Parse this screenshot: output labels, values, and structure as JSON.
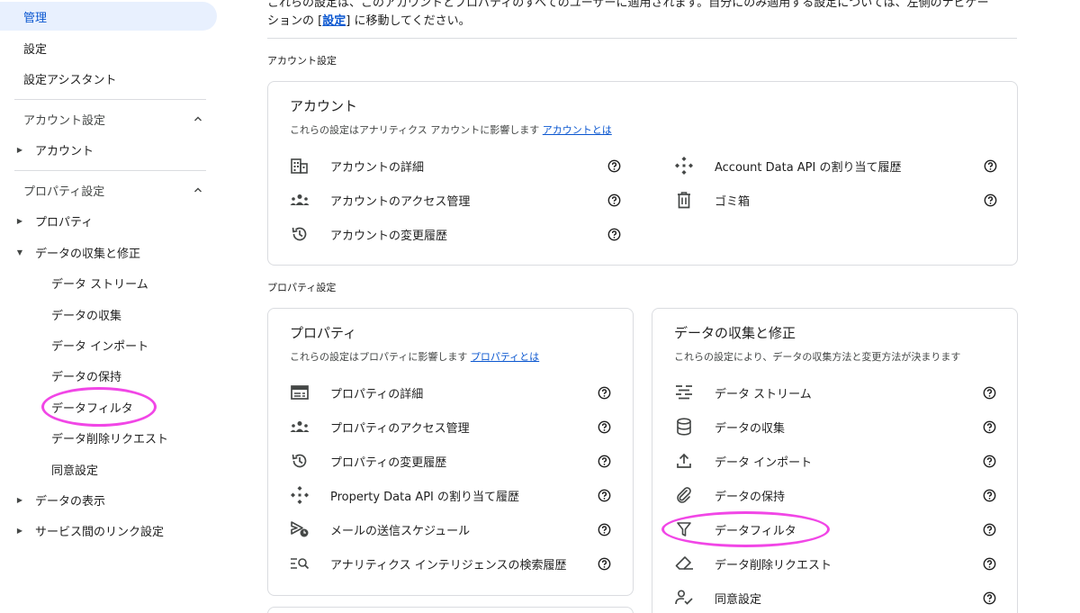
{
  "sidebar": {
    "top_items": [
      "管理",
      "設定",
      "設定アシスタント"
    ],
    "account_section": {
      "label": "アカウント設定",
      "items": [
        "アカウント"
      ]
    },
    "property_section": {
      "label": "プロパティ設定",
      "items": [
        "プロパティ",
        "データの収集と修正"
      ],
      "subitems": [
        "データ ストリーム",
        "データの収集",
        "データ インポート",
        "データの保持",
        "データフィルタ",
        "データ削除リクエスト",
        "同意設定"
      ],
      "more_items": [
        "データの表示",
        "サービス間のリンク設定"
      ]
    }
  },
  "main": {
    "intro_line1": "これらの設定は、このアカウントとプロパティのすべてのユーザーに適用されます。自分にのみ適用する設定については、左側のナビゲー",
    "intro_line2_prefix": "ションの [",
    "intro_line2_link": "設定",
    "intro_line2_suffix": "] に移動してください。",
    "account_group_label": "アカウント設定",
    "property_group_label": "プロパティ設定",
    "account_card": {
      "title": "アカウント",
      "desc": "これらの設定はアナリティクス アカウントに影響します ",
      "link": "アカウントとは",
      "left_rows": [
        {
          "label": "アカウントの詳細",
          "icon": "building-icon"
        },
        {
          "label": "アカウントのアクセス管理",
          "icon": "people-icon"
        },
        {
          "label": "アカウントの変更履歴",
          "icon": "history-icon"
        }
      ],
      "right_rows": [
        {
          "label": "Account Data API の割り当て履歴",
          "icon": "api-icon"
        },
        {
          "label": "ゴミ箱",
          "icon": "trash-icon"
        }
      ]
    },
    "property_card": {
      "title": "プロパティ",
      "desc": "これらの設定はプロパティに影響します ",
      "link": "プロパティとは",
      "rows": [
        {
          "label": "プロパティの詳細",
          "icon": "details-icon"
        },
        {
          "label": "プロパティのアクセス管理",
          "icon": "people-icon"
        },
        {
          "label": "プロパティの変更履歴",
          "icon": "history-icon"
        },
        {
          "label": "Property Data API の割り当て履歴",
          "icon": "api-icon"
        },
        {
          "label": "メールの送信スケジュール",
          "icon": "schedule-send-icon"
        },
        {
          "label": "アナリティクス インテリジェンスの検索履歴",
          "icon": "search-history-icon"
        }
      ]
    },
    "data_card": {
      "title": "データの収集と修正",
      "desc": "これらの設定により、データの収集方法と変更方法が決まります",
      "rows": [
        {
          "label": "データ ストリーム",
          "icon": "stream-icon"
        },
        {
          "label": "データの収集",
          "icon": "database-icon"
        },
        {
          "label": "データ インポート",
          "icon": "upload-icon"
        },
        {
          "label": "データの保持",
          "icon": "attach-icon"
        },
        {
          "label": "データフィルタ",
          "icon": "filter-icon"
        },
        {
          "label": "データ削除リクエスト",
          "icon": "eraser-icon"
        },
        {
          "label": "同意設定",
          "icon": "consent-icon"
        }
      ]
    }
  },
  "colors": {
    "accent": "#0b57d0",
    "highlight": "#f146e6",
    "active_bg": "#e8f0fe"
  }
}
